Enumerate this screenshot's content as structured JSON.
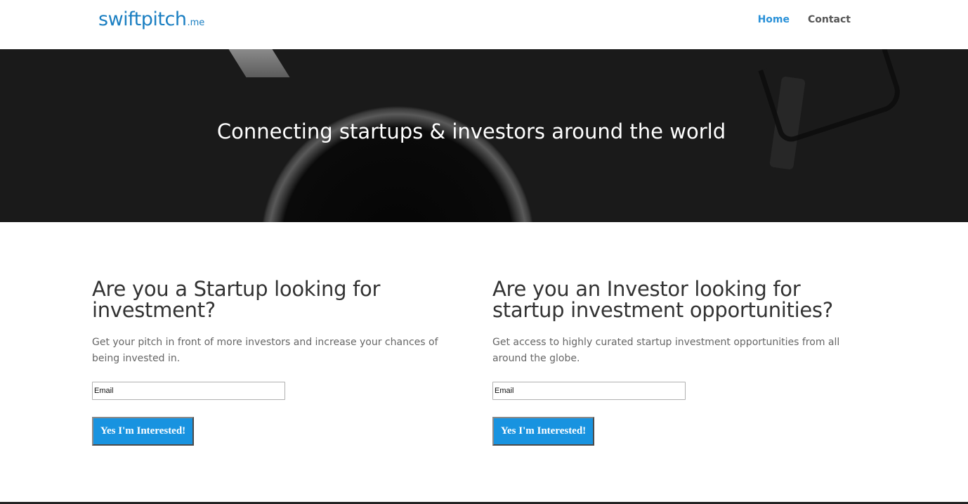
{
  "brand": {
    "logo_main": "swiftpitch",
    "logo_tld": ".me",
    "color": "#1b7fc2"
  },
  "nav": {
    "items": [
      {
        "label": "Home",
        "active": true
      },
      {
        "label": "Contact",
        "active": false
      }
    ],
    "active_color": "#2a91d8"
  },
  "hero": {
    "title": "Connecting startups & investors around the world"
  },
  "startup": {
    "heading": "Are you a Startup looking for investment?",
    "text": "Get your pitch in front of more investors and increase your chances of being invested in.",
    "email_placeholder": "Email",
    "button_label": "Yes I'm Interested!"
  },
  "investor": {
    "heading": "Are you an Investor looking for startup investment opportunities?",
    "text": "Get access to highly curated startup investment opportunities from all around the globe.",
    "email_placeholder": "Email",
    "button_label": "Yes I'm Interested!"
  },
  "colors": {
    "button": "#1893e0",
    "heading": "#333333",
    "body_text": "#666666"
  }
}
